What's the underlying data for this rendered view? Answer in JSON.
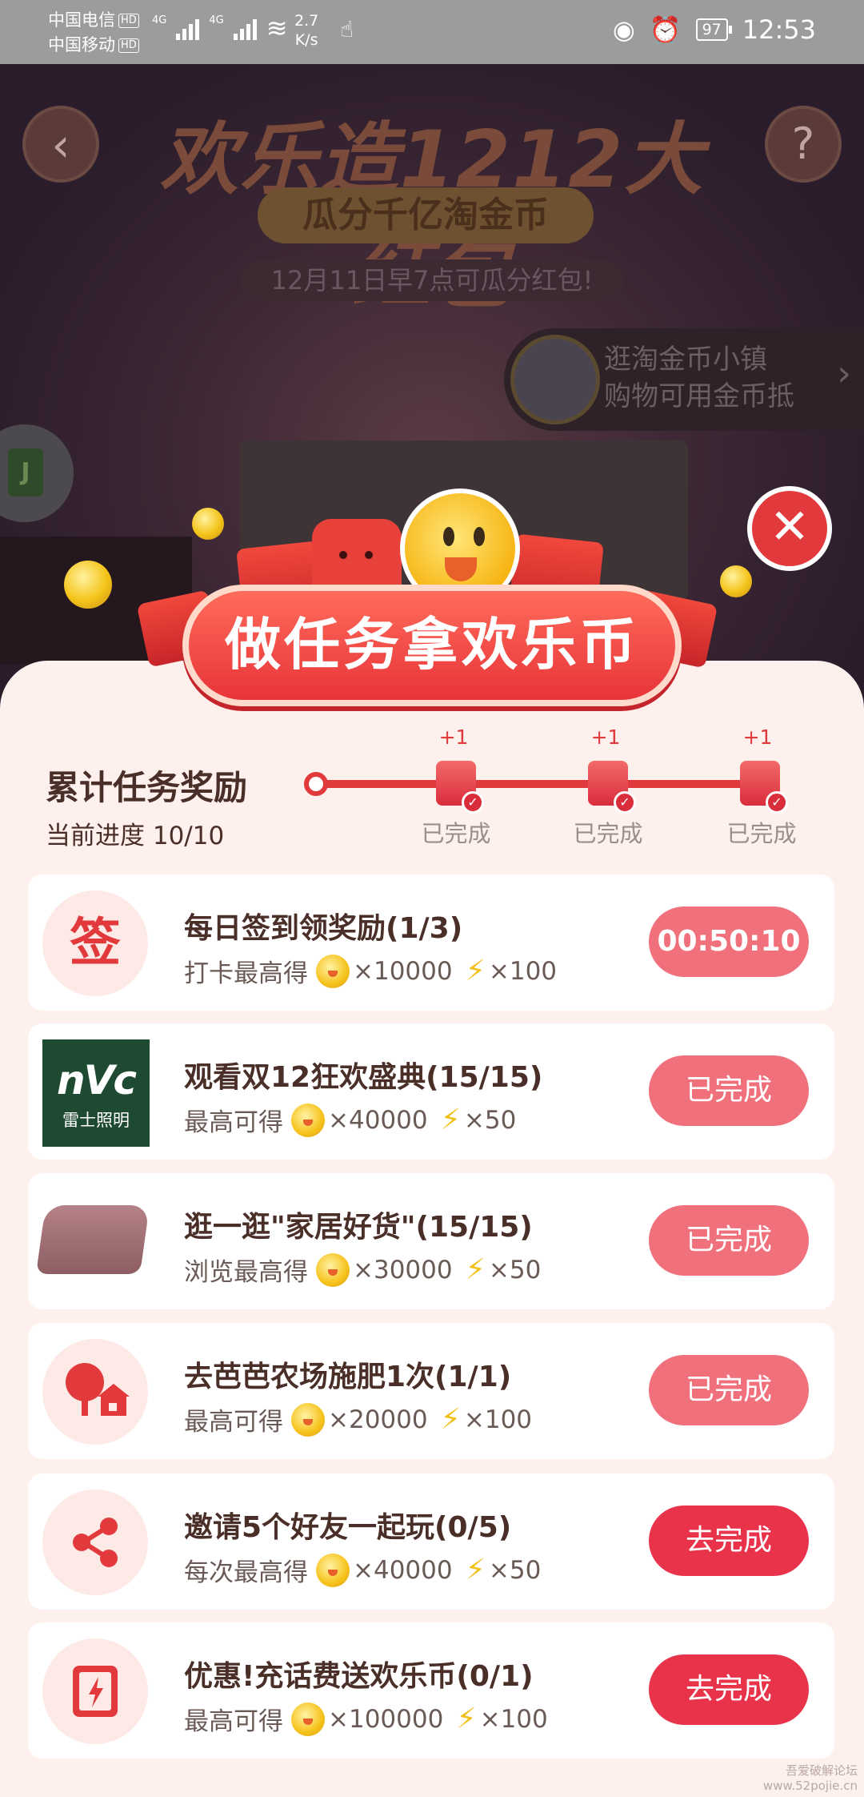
{
  "status_bar": {
    "carrier1": "中国电信",
    "carrier2": "中国移动",
    "hd": "HD",
    "net1": "4G",
    "net2": "4G",
    "speed_value": "2.7",
    "speed_unit": "K/s",
    "battery": "97",
    "time": "12:53"
  },
  "background": {
    "banner_title": "欢乐造1212大红包",
    "banner_subtitle": "瓜分千亿淘金币",
    "banner_note": "12月11日早7点可瓜分红包!",
    "town_line1": "逛淘金币小镇",
    "town_line2": "购物可用金币抵",
    "side_icon_letter": "J"
  },
  "popup": {
    "title": "做任务拿欢乐币",
    "close_glyph": "✕"
  },
  "progress": {
    "title": "累计任务奖励",
    "subtitle": "当前进度 10/10",
    "milestones": [
      {
        "plus": "+1",
        "label": "已完成"
      },
      {
        "plus": "+1",
        "label": "已完成"
      },
      {
        "plus": "+1",
        "label": "已完成"
      }
    ]
  },
  "tasks": [
    {
      "icon": "sign-in-icon",
      "icon_text": "签",
      "title": "每日签到领奖励(1/3)",
      "reward_label": "打卡最高得",
      "coins": "×10000",
      "energy": "×100",
      "button": "00:50:10",
      "button_state": "timer"
    },
    {
      "icon": "nvc-logo",
      "icon_text": "nVc",
      "icon_sub": "雷士照明",
      "title": "观看双12狂欢盛典(15/15)",
      "reward_label": "最高可得",
      "coins": "×40000",
      "energy": "×50",
      "button": "已完成",
      "button_state": "done"
    },
    {
      "icon": "pillow-product-icon",
      "title": "逛一逛\"家居好货\"(15/15)",
      "reward_label": "浏览最高得",
      "coins": "×30000",
      "energy": "×50",
      "button": "已完成",
      "button_state": "done"
    },
    {
      "icon": "farm-tree-icon",
      "title": "去芭芭农场施肥1次(1/1)",
      "reward_label": "最高可得",
      "coins": "×20000",
      "energy": "×100",
      "button": "已完成",
      "button_state": "done"
    },
    {
      "icon": "share-icon",
      "title": "邀请5个好友一起玩(0/5)",
      "reward_label": "每次最高得",
      "coins": "×40000",
      "energy": "×50",
      "button": "去完成",
      "button_state": "go"
    },
    {
      "icon": "phone-charge-icon",
      "title": "优惠!充话费送欢乐币(0/1)",
      "reward_label": "最高可得",
      "coins": "×100000",
      "energy": "×100",
      "button": "去完成",
      "button_state": "go"
    }
  ],
  "watermark": {
    "line1": "吾爱破解论坛",
    "line2": "www.52pojie.cn"
  },
  "colors": {
    "accent": "#e8334a",
    "done": "#f0707c",
    "panel": "#fdf0ed"
  }
}
